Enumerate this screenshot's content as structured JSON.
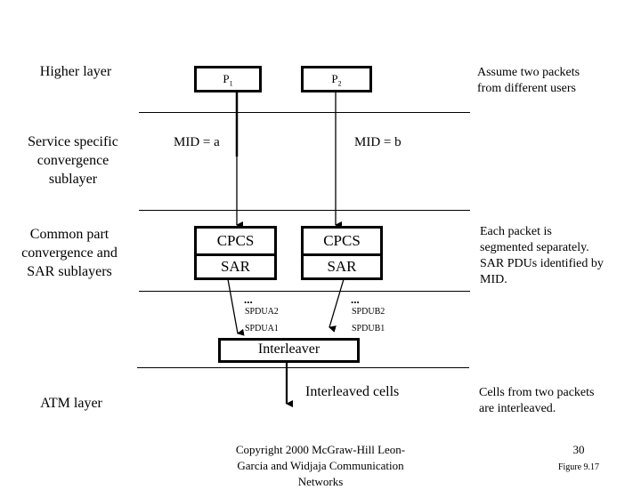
{
  "layers": {
    "higher": "Higher layer",
    "sscs": [
      "Service specific",
      "convergence",
      "sublayer"
    ],
    "cpcs_sar": [
      "Common part",
      "convergence and",
      "SAR sublayers"
    ],
    "atm": "ATM layer"
  },
  "packets": {
    "p1": {
      "base": "P",
      "sub": "1"
    },
    "p2": {
      "base": "P",
      "sub": "2"
    }
  },
  "mid_labels": {
    "a": "MID = a",
    "b": "MID = b"
  },
  "cpcs_boxes": {
    "a": {
      "top": "CPCS",
      "bottom": "SAR"
    },
    "b": {
      "top": "CPCS",
      "bottom": "SAR"
    }
  },
  "pdus": {
    "a": {
      "dots": "...",
      "items": [
        "SPDUA2",
        "SPDUA1"
      ]
    },
    "b": {
      "dots": "...",
      "items": [
        "SPDUB2",
        "SPDUB1"
      ]
    }
  },
  "interleaver": "Interleaver",
  "interleaved_cells": "Interleaved cells",
  "notes": {
    "assume": [
      "Assume two packets",
      "from different users"
    ],
    "segmented": [
      "Each packet is",
      "segmented separately.",
      "SAR PDUs identified by",
      "MID."
    ],
    "cells": [
      "Cells from two packets",
      "are interleaved."
    ]
  },
  "footer": {
    "copyright": [
      "Copyright 2000 McGraw-Hill  Leon-",
      "Garcia and Widjaja  Communication",
      "Networks"
    ],
    "page_number": "30",
    "figure": "Figure 9.17"
  }
}
